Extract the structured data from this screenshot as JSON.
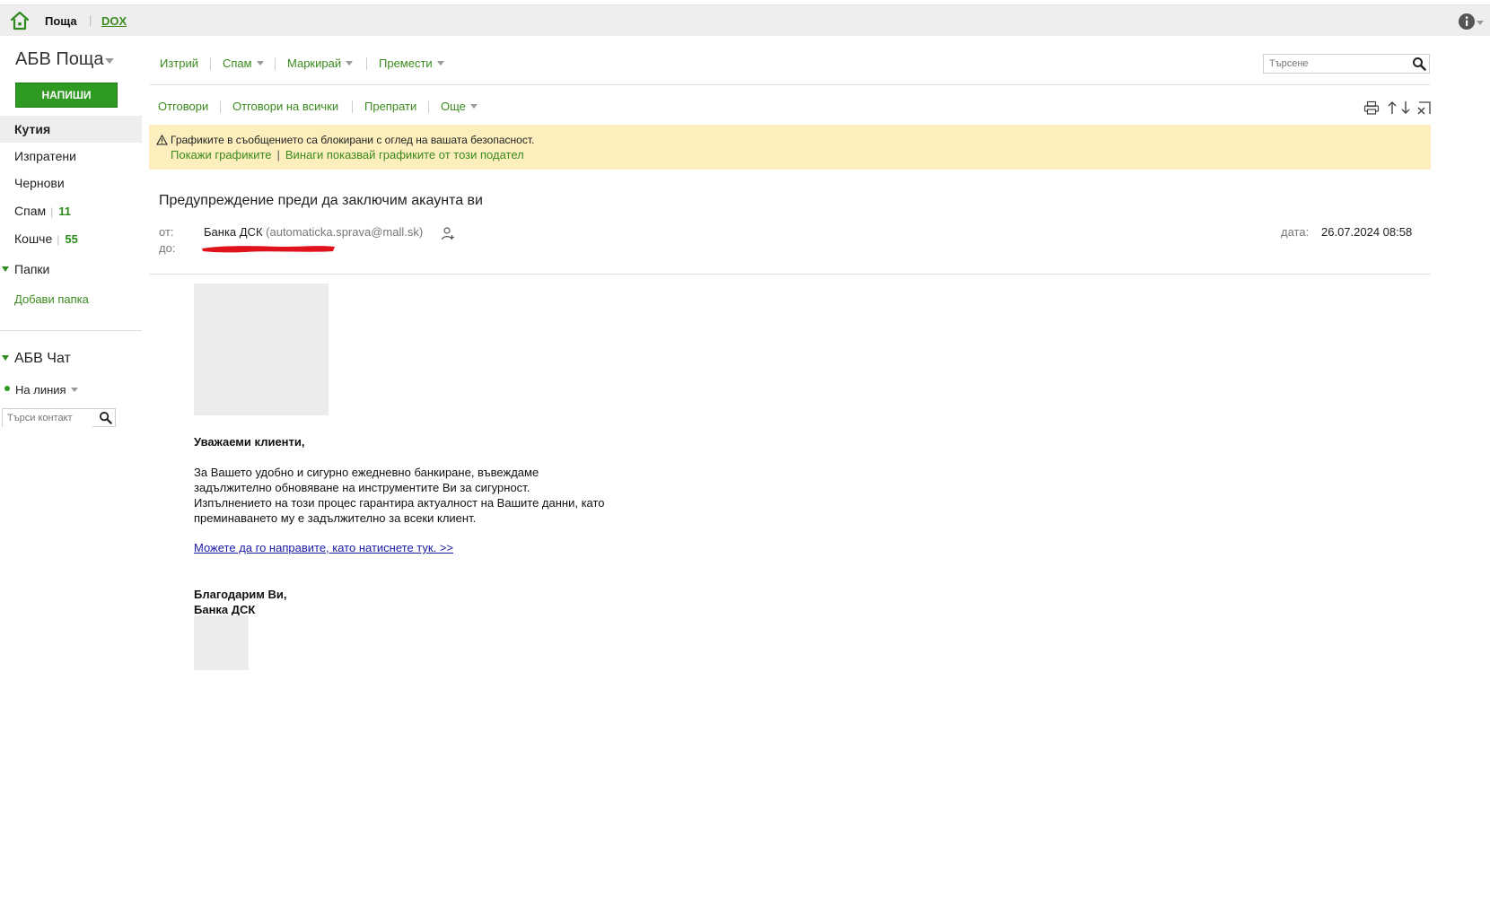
{
  "topbar": {
    "mail_label": "Поща",
    "dox_label": "DOX"
  },
  "sidebar": {
    "brand": "АБВ Поща",
    "compose_label": "НАПИШИ",
    "items": [
      {
        "label": "Кутия",
        "count": ""
      },
      {
        "label": "Изпратени",
        "count": ""
      },
      {
        "label": "Чернови",
        "count": ""
      },
      {
        "label": "Спам",
        "count": "11"
      },
      {
        "label": "Кошче",
        "count": "55"
      }
    ],
    "folders_label": "Папки",
    "add_folder_label": "Добави папка",
    "chat_title": "АБВ Чат",
    "status_label": "На линия",
    "contact_search_placeholder": "Търси контакт"
  },
  "toolbar": {
    "delete_label": "Изтрий",
    "spam_label": "Спам",
    "mark_label": "Маркирай",
    "move_label": "Премести",
    "search_placeholder": "Търсене"
  },
  "message_actions": {
    "reply_label": "Отговори",
    "reply_all_label": "Отговори на всички",
    "forward_label": "Препрати",
    "more_label": "Още"
  },
  "warning": {
    "text": "Графиките в съобщението са блокирани с оглед на вашата безопасност.",
    "show_label": "Покажи графиките",
    "separator": "|",
    "always_show_label": "Винаги показвай графиките от този подател"
  },
  "message": {
    "subject": "Предупреждение преди да заключим акаунта ви",
    "from_label": "от:",
    "to_label": "до:",
    "from_name": "Банка ДСК",
    "from_email": "(automaticka.sprava@mall.sk)",
    "date_label": "дата:",
    "date_value": "26.07.2024 08:58",
    "greeting": "Уважаеми клиенти,",
    "paragraph_lines": [
      "За Вашето удобно и сигурно ежедневно банкиране, въвеждаме",
      "задължително обновяване на инструментите Ви за сигурност.",
      "Изпълнението на този процес гарантира актуалност на Вашите данни, като",
      "преминаването му е задължително за всеки клиент."
    ],
    "link_text": "Можете да го направите, като натиснете тук. >>",
    "signoff_1": "Благодарим Ви,",
    "signoff_2": "Банка ДСК"
  },
  "colors": {
    "accent_green": "#3b8a1e",
    "compose_green": "#2f9a22",
    "warning_bg": "#fcefbd",
    "link_blue": "#1a1aa6",
    "redaction_red": "#e0131d"
  }
}
